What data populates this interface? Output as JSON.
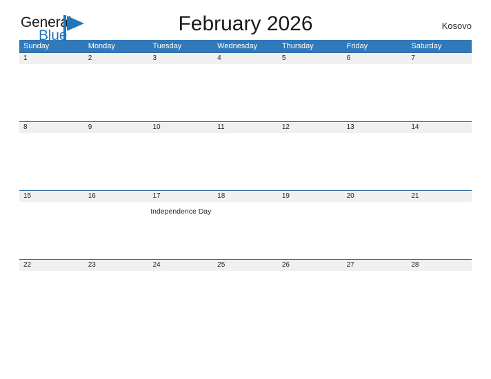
{
  "brand": {
    "name_part1": "General",
    "name_part2": "Blue",
    "mark_icon": "flag-triangle-icon",
    "accent_color": "#1f76bc"
  },
  "header": {
    "title": "February 2026",
    "region": "Kosovo"
  },
  "colors": {
    "header_blue": "#3179b8",
    "row_divider_blue": "#2e6da4",
    "daynum_band_gray": "#f0f0f0",
    "text_dark": "#1a1a1a"
  },
  "calendar": {
    "weekdays": [
      "Sunday",
      "Monday",
      "Tuesday",
      "Wednesday",
      "Thursday",
      "Friday",
      "Saturday"
    ],
    "weeks": [
      {
        "days": [
          {
            "num": "1",
            "event": ""
          },
          {
            "num": "2",
            "event": ""
          },
          {
            "num": "3",
            "event": ""
          },
          {
            "num": "4",
            "event": ""
          },
          {
            "num": "5",
            "event": ""
          },
          {
            "num": "6",
            "event": ""
          },
          {
            "num": "7",
            "event": ""
          }
        ]
      },
      {
        "days": [
          {
            "num": "8",
            "event": ""
          },
          {
            "num": "9",
            "event": ""
          },
          {
            "num": "10",
            "event": ""
          },
          {
            "num": "11",
            "event": ""
          },
          {
            "num": "12",
            "event": ""
          },
          {
            "num": "13",
            "event": ""
          },
          {
            "num": "14",
            "event": ""
          }
        ]
      },
      {
        "days": [
          {
            "num": "15",
            "event": ""
          },
          {
            "num": "16",
            "event": ""
          },
          {
            "num": "17",
            "event": "Independence Day"
          },
          {
            "num": "18",
            "event": ""
          },
          {
            "num": "19",
            "event": ""
          },
          {
            "num": "20",
            "event": ""
          },
          {
            "num": "21",
            "event": ""
          }
        ]
      },
      {
        "days": [
          {
            "num": "22",
            "event": ""
          },
          {
            "num": "23",
            "event": ""
          },
          {
            "num": "24",
            "event": ""
          },
          {
            "num": "25",
            "event": ""
          },
          {
            "num": "26",
            "event": ""
          },
          {
            "num": "27",
            "event": ""
          },
          {
            "num": "28",
            "event": ""
          }
        ]
      }
    ]
  }
}
